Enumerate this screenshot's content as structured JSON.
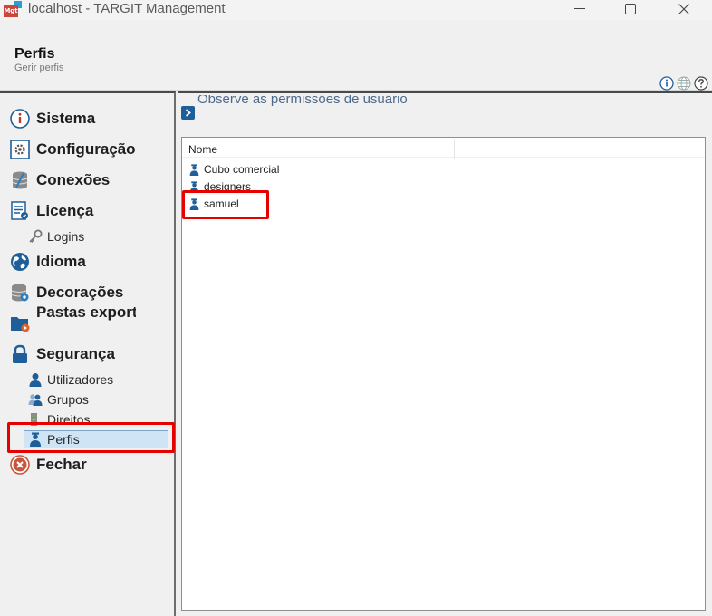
{
  "window": {
    "title": "localhost - TARGIT Management",
    "logo_text": "Mgt"
  },
  "header": {
    "title": "Perfis",
    "subtitle": "Gerir perfis"
  },
  "sidebar": {
    "items": [
      {
        "label": "Sistema",
        "icon": "info-icon"
      },
      {
        "label": "Configuração",
        "icon": "config-icon"
      },
      {
        "label": "Conexões",
        "icon": "database-icon"
      },
      {
        "label": "Licença",
        "icon": "license-icon"
      },
      {
        "label": "Logins",
        "icon": "key-icon"
      },
      {
        "label": "Idioma",
        "icon": "globe-icon"
      },
      {
        "label": "Decorações",
        "icon": "decorations-icon"
      },
      {
        "label": "Pastas exportação",
        "icon": "export-folder-icon"
      },
      {
        "label": "Segurança",
        "icon": "lock-icon"
      },
      {
        "label": "Utilizadores",
        "icon": "user-icon"
      },
      {
        "label": "Grupos",
        "icon": "group-icon"
      },
      {
        "label": "Direitos",
        "icon": "rights-icon"
      },
      {
        "label": "Perfis",
        "icon": "profile-icon",
        "selected": true
      },
      {
        "label": "Fechar",
        "icon": "close-circle-icon"
      }
    ]
  },
  "main": {
    "info_text": "Observe as permissões de usuário",
    "column_header": "Nome",
    "rows": [
      {
        "label": "Cubo comercial"
      },
      {
        "label": "designers"
      },
      {
        "label": "samuel"
      }
    ]
  },
  "colors": {
    "accent": "#1f5f99",
    "selection": "#cfe4f5",
    "highlight": "#e60000"
  }
}
